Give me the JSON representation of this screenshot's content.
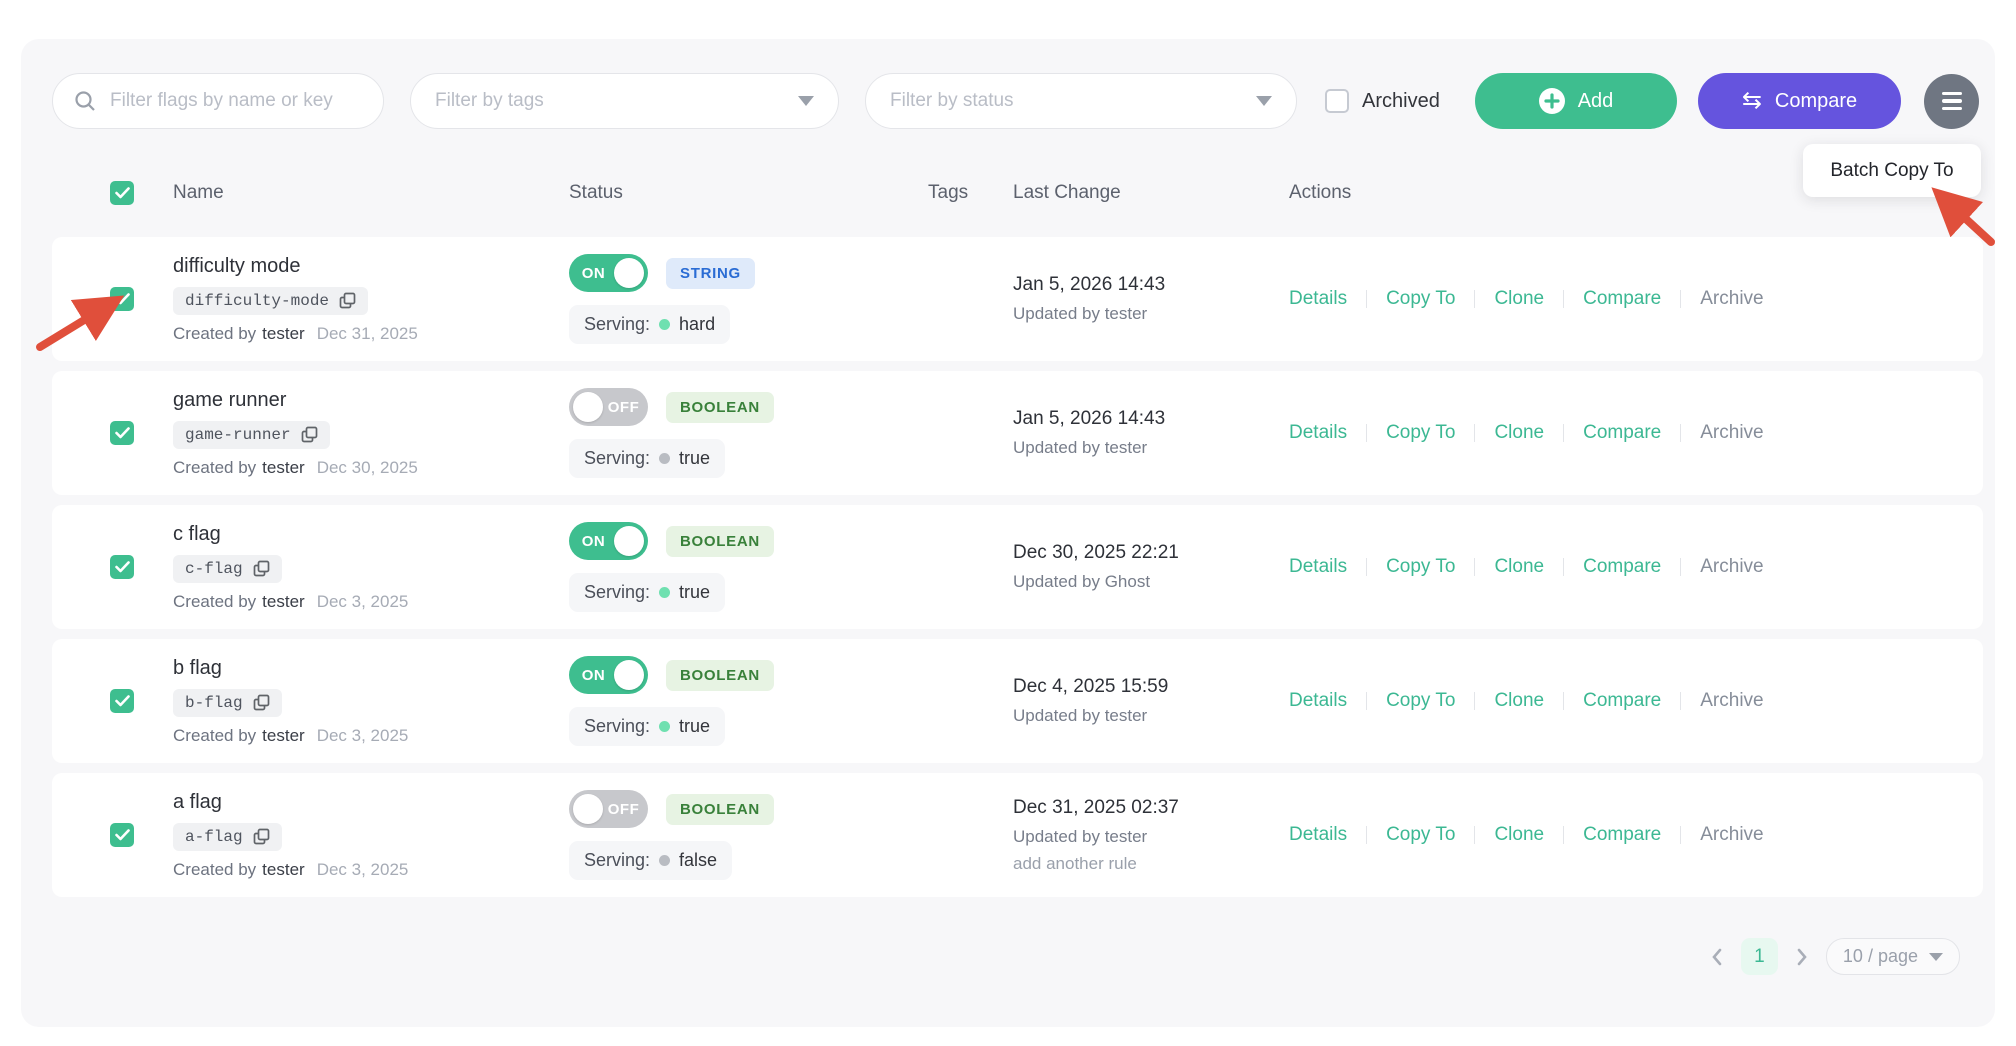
{
  "filters": {
    "search_placeholder": "Filter flags by name or key",
    "tags_placeholder": "Filter by tags",
    "status_placeholder": "Filter by status",
    "archived_label": "Archived"
  },
  "toolbar": {
    "add_label": "Add",
    "compare_label": "Compare",
    "batch_menu_item": "Batch Copy To"
  },
  "table": {
    "headers": {
      "name": "Name",
      "status": "Status",
      "tags": "Tags",
      "last_change": "Last Change",
      "actions": "Actions"
    },
    "created_by_label": "Created by",
    "updated_by_label": "Updated by",
    "serving_label": "Serving:",
    "action_labels": [
      "Details",
      "Copy To",
      "Clone",
      "Compare",
      "Archive"
    ],
    "rows": [
      {
        "name": "difficulty mode",
        "key": "difficulty-mode",
        "created_by": "tester",
        "created_date": "Dec 31, 2025",
        "toggle": "ON",
        "type": "STRING",
        "serving": "hard",
        "change_date": "Jan 5, 2026 14:43",
        "updated_by": "tester",
        "extra": null
      },
      {
        "name": "game runner",
        "key": "game-runner",
        "created_by": "tester",
        "created_date": "Dec 30, 2025",
        "toggle": "OFF",
        "type": "BOOLEAN",
        "serving": "true",
        "change_date": "Jan 5, 2026 14:43",
        "updated_by": "tester",
        "extra": null
      },
      {
        "name": "c flag",
        "key": "c-flag",
        "created_by": "tester",
        "created_date": "Dec 3, 2025",
        "toggle": "ON",
        "type": "BOOLEAN",
        "serving": "true",
        "change_date": "Dec 30, 2025 22:21",
        "updated_by": "Ghost",
        "extra": null
      },
      {
        "name": "b flag",
        "key": "b-flag",
        "created_by": "tester",
        "created_date": "Dec 3, 2025",
        "toggle": "ON",
        "type": "BOOLEAN",
        "serving": "true",
        "change_date": "Dec 4, 2025 15:59",
        "updated_by": "tester",
        "extra": null
      },
      {
        "name": "a flag",
        "key": "a-flag",
        "created_by": "tester",
        "created_date": "Dec 3, 2025",
        "toggle": "OFF",
        "type": "BOOLEAN",
        "serving": "false",
        "change_date": "Dec 31, 2025 02:37",
        "updated_by": "tester",
        "extra": "add another rule"
      }
    ]
  },
  "pagination": {
    "current_page": "1",
    "page_size": "10 / page"
  },
  "colors": {
    "accent_green": "#3ebe8f",
    "accent_purple": "#6554de",
    "link_green": "#3cb893",
    "badge_blue_bg": "#dfeafa",
    "badge_blue_text": "#2a6cd4",
    "badge_green_bg": "#e7f3e3",
    "badge_green_text": "#39813a",
    "annotation_red": "#e04f3b"
  }
}
